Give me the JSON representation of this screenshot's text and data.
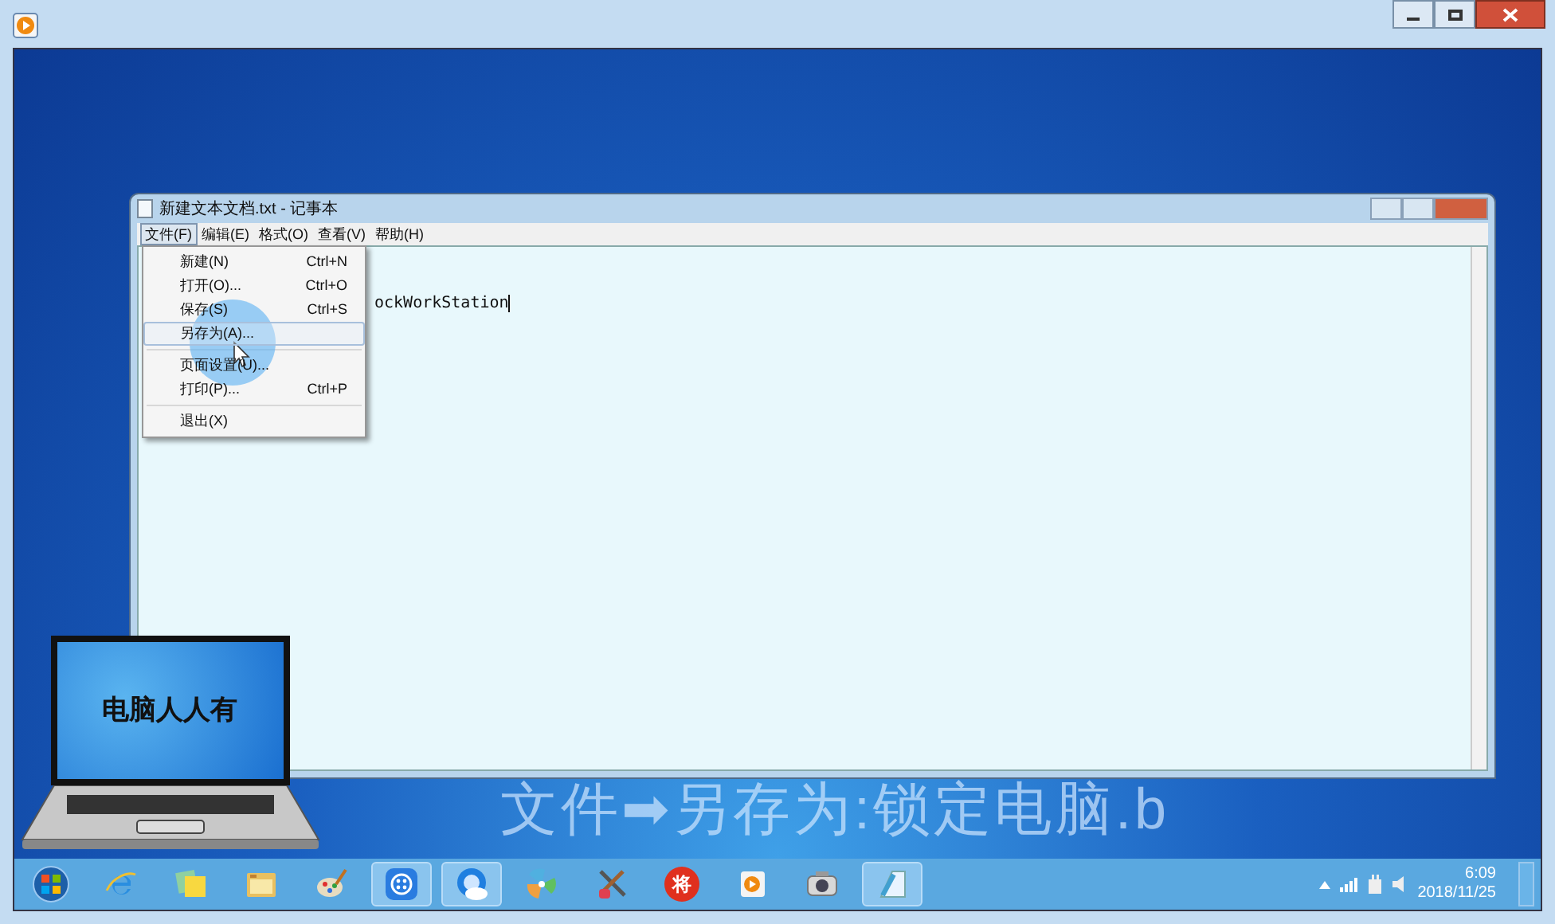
{
  "notepad": {
    "title": "新建文本文档.txt - 记事本",
    "menu_bar": [
      {
        "label": "文件(F)",
        "selected": true
      },
      {
        "label": "编辑(E)",
        "selected": false
      },
      {
        "label": "格式(O)",
        "selected": false
      },
      {
        "label": "查看(V)",
        "selected": false
      },
      {
        "label": "帮助(H)",
        "selected": false
      }
    ],
    "text": "ockWorkStation",
    "file_menu": [
      {
        "kind": "item",
        "label": "新建(N)",
        "shortcut": "Ctrl+N",
        "selected": false
      },
      {
        "kind": "item",
        "label": "打开(O)...",
        "shortcut": "Ctrl+O",
        "selected": false
      },
      {
        "kind": "item",
        "label": "保存(S)",
        "shortcut": "Ctrl+S",
        "selected": false
      },
      {
        "kind": "item",
        "label": "另存为(A)...",
        "selected": true
      },
      {
        "kind": "separator"
      },
      {
        "kind": "item",
        "label": "页面设置(U)...",
        "selected": false
      },
      {
        "kind": "item",
        "label": "打印(P)...",
        "shortcut": "Ctrl+P",
        "selected": false
      },
      {
        "kind": "separator"
      },
      {
        "kind": "item",
        "label": "退出(X)",
        "selected": false
      }
    ]
  },
  "logo": {
    "text": "电脑人人有"
  },
  "subtitle": "文件➡另存为:锁定电脑.b",
  "taskbar": {
    "items": [
      {
        "kind": "start",
        "active": false
      },
      {
        "kind": "ie",
        "active": false
      },
      {
        "kind": "notes",
        "active": false
      },
      {
        "kind": "folder",
        "active": false
      },
      {
        "kind": "paint",
        "active": false
      },
      {
        "kind": "dots",
        "active": true
      },
      {
        "kind": "cloud",
        "active": true
      },
      {
        "kind": "pinwheel",
        "active": false
      },
      {
        "kind": "tools",
        "active": false
      },
      {
        "kind": "badge",
        "label": "将",
        "active": false
      },
      {
        "kind": "player",
        "active": false
      },
      {
        "kind": "camera",
        "active": false
      },
      {
        "kind": "notepad",
        "active": true
      }
    ],
    "time": "6:09",
    "date": "2018/11/25"
  }
}
